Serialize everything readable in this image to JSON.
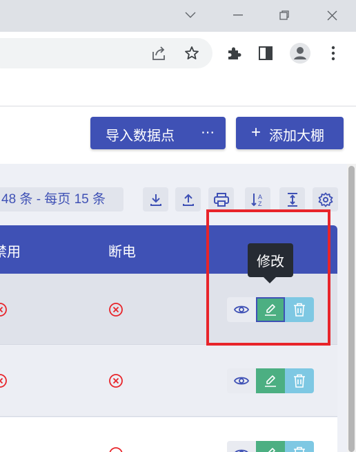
{
  "window_controls": {
    "dropdown_icon": "chevron-down",
    "minimize_icon": "minimize",
    "restore_icon": "restore",
    "close_icon": "close"
  },
  "browser_toolbar": {
    "share_icon": "share",
    "bookmark_icon": "star",
    "extensions_icon": "puzzle",
    "sidepanel_icon": "side-panel",
    "profile_icon": "person",
    "menu_icon": "three-dots-vertical"
  },
  "actions": {
    "import_label": "导入数据点",
    "import_more": "⋯",
    "add_plus": "+",
    "add_label": "添加大棚"
  },
  "pager": {
    "text": "48 条 - 每页 15 条"
  },
  "table_tools": [
    "download",
    "upload",
    "print",
    "sort-az",
    "vertical-align",
    "settings"
  ],
  "table": {
    "columns": [
      "禁用",
      "断电"
    ],
    "rows": [
      {
        "disabled_icon": "x-circle",
        "power_off_icon": "x-circle"
      },
      {
        "disabled_icon": "x-circle",
        "power_off_icon": "x-circle"
      },
      {
        "disabled_icon": "x-circle",
        "power_off_icon": "x-circle"
      }
    ]
  },
  "tooltip": {
    "text": "修改"
  },
  "colors": {
    "primary": "#3f51b5",
    "edit_green": "#4caf82",
    "delete_blue": "#7ec8e3",
    "error_red": "#e8242a",
    "highlight_red": "#e8242a"
  }
}
